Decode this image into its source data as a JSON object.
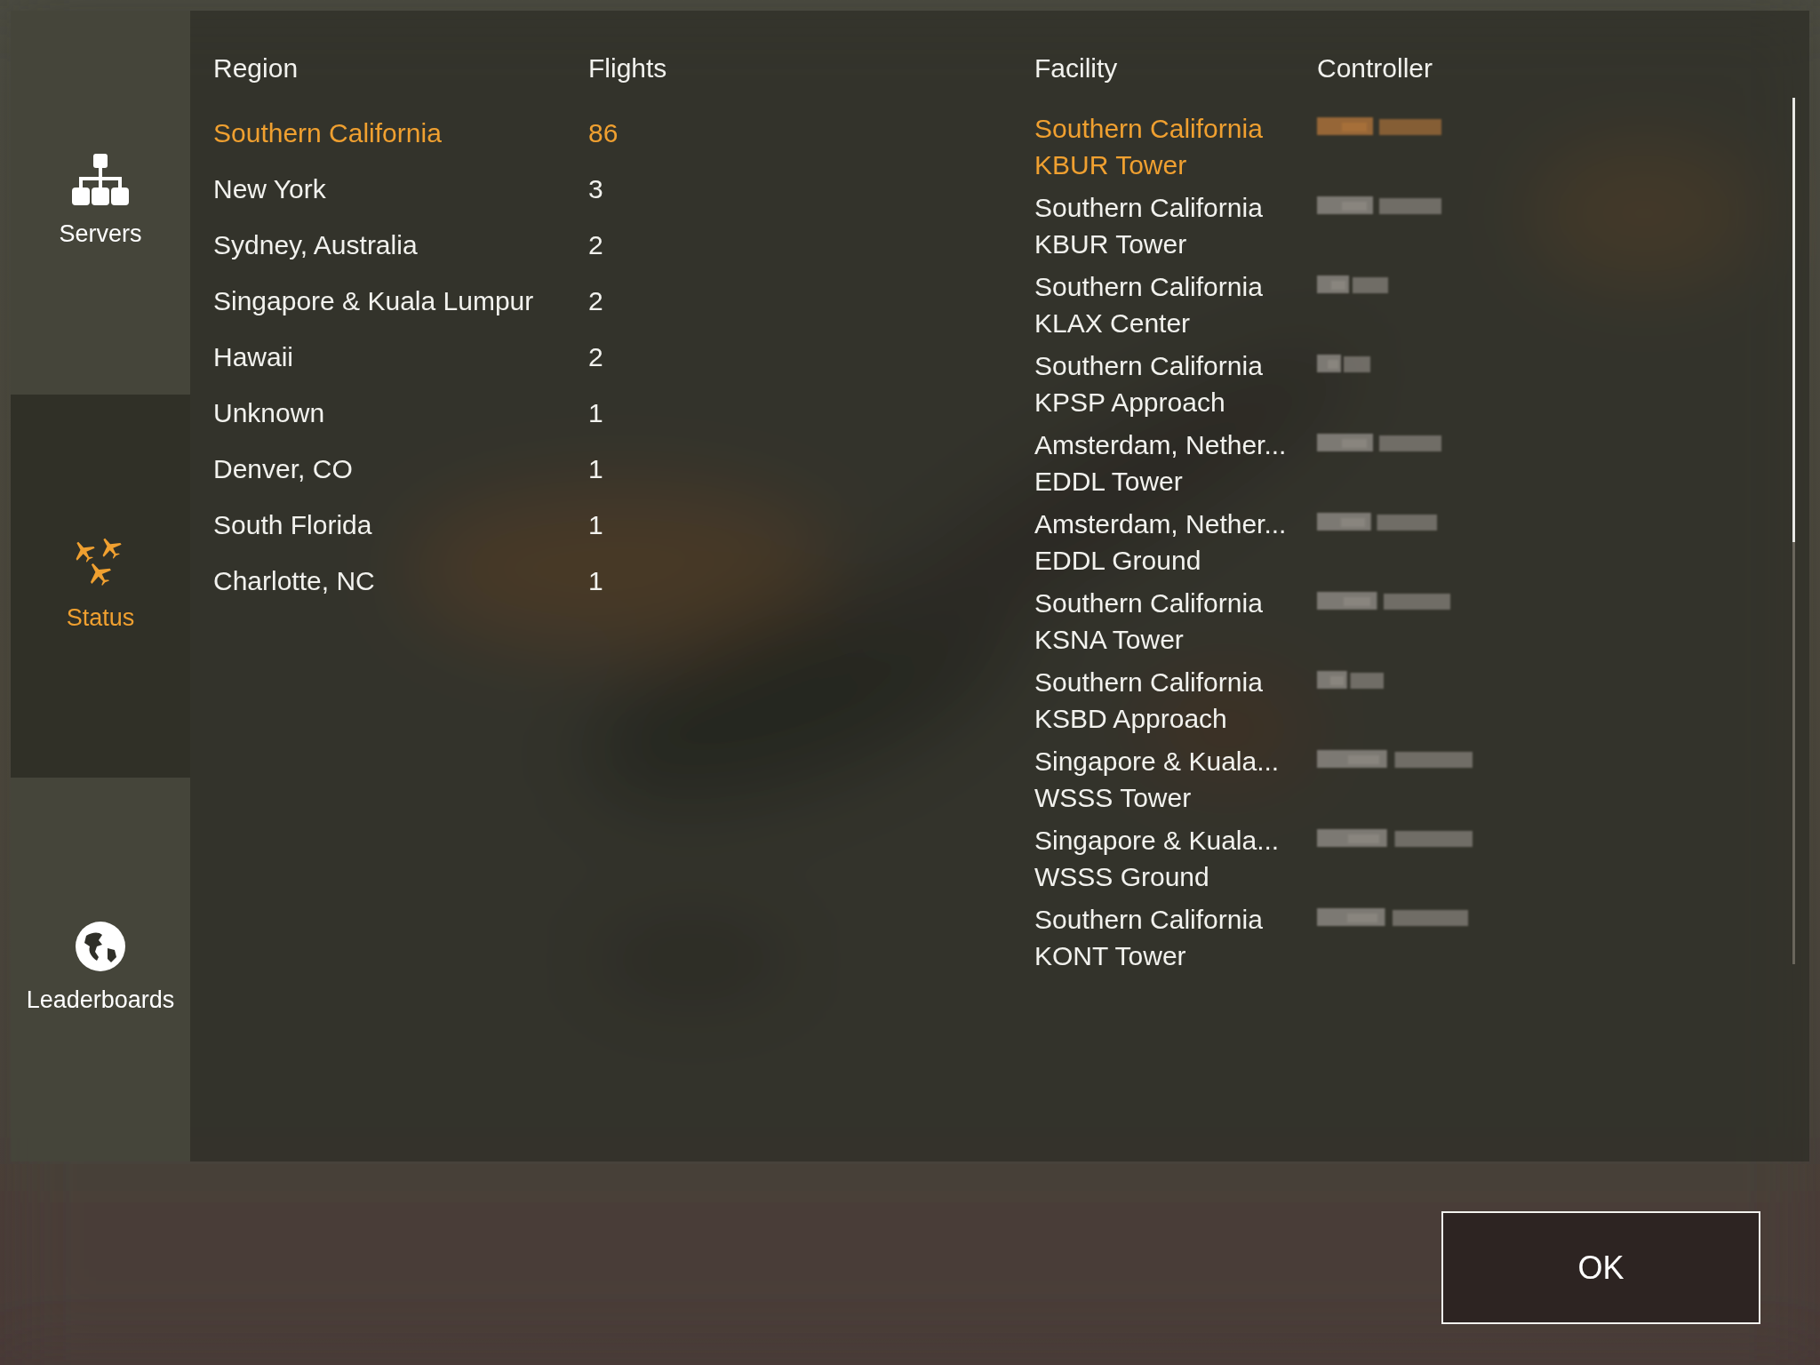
{
  "sidebar": {
    "items": [
      {
        "kind": "servers",
        "label": "Servers",
        "selected": false
      },
      {
        "kind": "status",
        "label": "Status",
        "selected": true
      },
      {
        "kind": "leaderboards",
        "label": "Leaderboards",
        "selected": false
      }
    ]
  },
  "regions": {
    "columns": [
      "Region",
      "Flights"
    ],
    "rows": [
      {
        "region": "Southern California",
        "flights": "86",
        "selected": true
      },
      {
        "region": "New York",
        "flights": "3",
        "selected": false
      },
      {
        "region": "Sydney, Australia",
        "flights": "2",
        "selected": false
      },
      {
        "region": "Singapore & Kuala Lumpur",
        "flights": "2",
        "selected": false
      },
      {
        "region": "Hawaii",
        "flights": "2",
        "selected": false
      },
      {
        "region": "Unknown",
        "flights": "1",
        "selected": false
      },
      {
        "region": "Denver, CO",
        "flights": "1",
        "selected": false
      },
      {
        "region": "South Florida",
        "flights": "1",
        "selected": false
      },
      {
        "region": "Charlotte, NC",
        "flights": "1",
        "selected": false
      }
    ]
  },
  "facilities": {
    "columns": [
      "Facility",
      "Controller"
    ],
    "rows": [
      {
        "region": "Southern California",
        "facility": "KBUR Tower",
        "selected": true
      },
      {
        "region": "Southern California",
        "facility": "KBUR Tower",
        "selected": false
      },
      {
        "region": "Southern California",
        "facility": "KLAX Center",
        "selected": false
      },
      {
        "region": "Southern California",
        "facility": "KPSP Approach",
        "selected": false
      },
      {
        "region": "Amsterdam, Nether...",
        "facility": "EDDL Tower",
        "selected": false
      },
      {
        "region": "Amsterdam, Nether...",
        "facility": "EDDL Ground",
        "selected": false
      },
      {
        "region": "Southern California",
        "facility": "KSNA Tower",
        "selected": false
      },
      {
        "region": "Southern California",
        "facility": "KSBD Approach",
        "selected": false
      },
      {
        "region": "Singapore & Kuala...",
        "facility": "WSSS Tower",
        "selected": false
      },
      {
        "region": "Singapore & Kuala...",
        "facility": "WSSS Ground",
        "selected": false
      },
      {
        "region": "Southern California",
        "facility": "KONT Tower",
        "selected": false
      }
    ]
  },
  "ok_button": "OK"
}
